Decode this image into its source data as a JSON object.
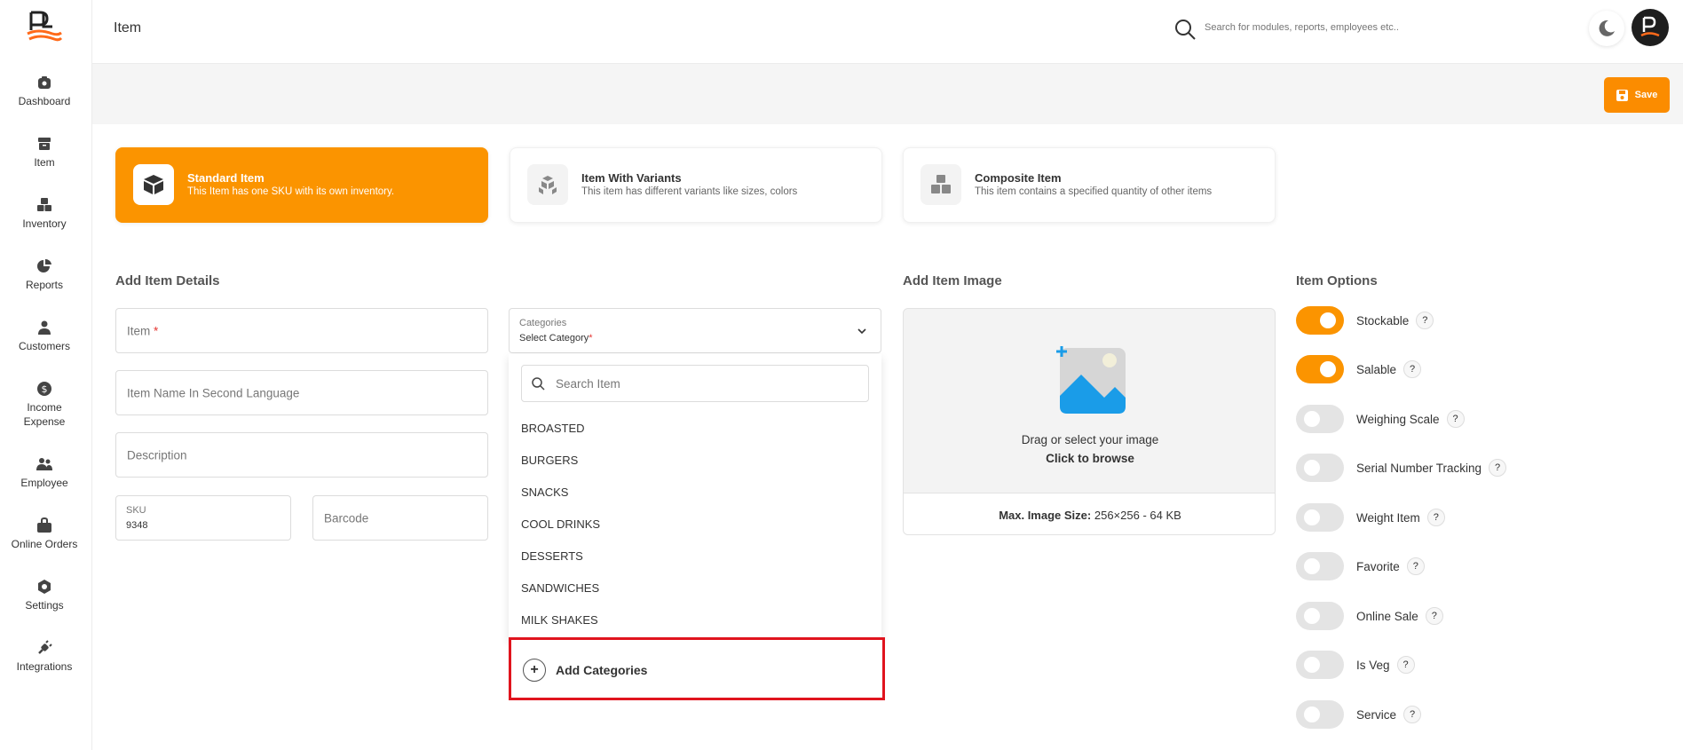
{
  "app": {
    "title": "Item",
    "search_placeholder": "Search for modules, reports, employees etc.."
  },
  "sidebar": {
    "items": [
      {
        "label": "Dashboard",
        "icon": "home-icon"
      },
      {
        "label": "Item",
        "icon": "archive-icon"
      },
      {
        "label": "Inventory",
        "icon": "boxes-icon"
      },
      {
        "label": "Reports",
        "icon": "pie-chart-icon"
      },
      {
        "label": "Customers",
        "icon": "users-icon"
      },
      {
        "label": "Income\nExpense",
        "icon": "dollar-icon"
      },
      {
        "label": "Employee",
        "icon": "employee-icon"
      },
      {
        "label": "Online Orders",
        "icon": "bag-icon"
      },
      {
        "label": "Settings",
        "icon": "gear-icon"
      },
      {
        "label": "Integrations",
        "icon": "plug-icon"
      }
    ]
  },
  "toolbar": {
    "save_label": "Save"
  },
  "item_types": [
    {
      "title": "Standard Item",
      "subtitle": "This Item has one SKU with its own inventory.",
      "active": true
    },
    {
      "title": "Item With Variants",
      "subtitle": "This item has different variants like sizes, colors",
      "active": false
    },
    {
      "title": "Composite Item",
      "subtitle": "This item contains a specified quantity of other items",
      "active": false
    }
  ],
  "details": {
    "title": "Add Item Details",
    "item_placeholder": "Item",
    "item_required": "*",
    "second_lang_placeholder": "Item Name In Second Language",
    "description_placeholder": "Description",
    "sku_label": "SKU",
    "sku_value": "9348",
    "barcode_placeholder": "Barcode",
    "categories_label": "Categories",
    "categories_value": "Select Category",
    "categories_required": "*"
  },
  "category_dropdown": {
    "search_placeholder": "Search Item",
    "items": [
      "BROASTED",
      "BURGERS",
      "SNACKS",
      "COOL DRINKS",
      "DESSERTS",
      "SANDWICHES",
      "MILK SHAKES"
    ],
    "add_label": "Add Categories"
  },
  "image": {
    "title": "Add Item Image",
    "drop_text": "Drag or select your image",
    "browse_text": "Click to browse",
    "max_size_label": "Max. Image Size:",
    "max_size_value": "256×256 - 64 KB"
  },
  "options": {
    "title": "Item Options",
    "items": [
      {
        "label": "Stockable",
        "on": true
      },
      {
        "label": "Salable",
        "on": true
      },
      {
        "label": "Weighing Scale",
        "on": false
      },
      {
        "label": "Serial Number Tracking",
        "on": false
      },
      {
        "label": "Weight Item",
        "on": false
      },
      {
        "label": "Favorite",
        "on": false
      },
      {
        "label": "Online Sale",
        "on": false
      },
      {
        "label": "Is Veg",
        "on": false
      },
      {
        "label": "Service",
        "on": false
      }
    ],
    "help_glyph": "?"
  },
  "colors": {
    "accent": "#fb9400",
    "highlight": "#e0141e"
  }
}
